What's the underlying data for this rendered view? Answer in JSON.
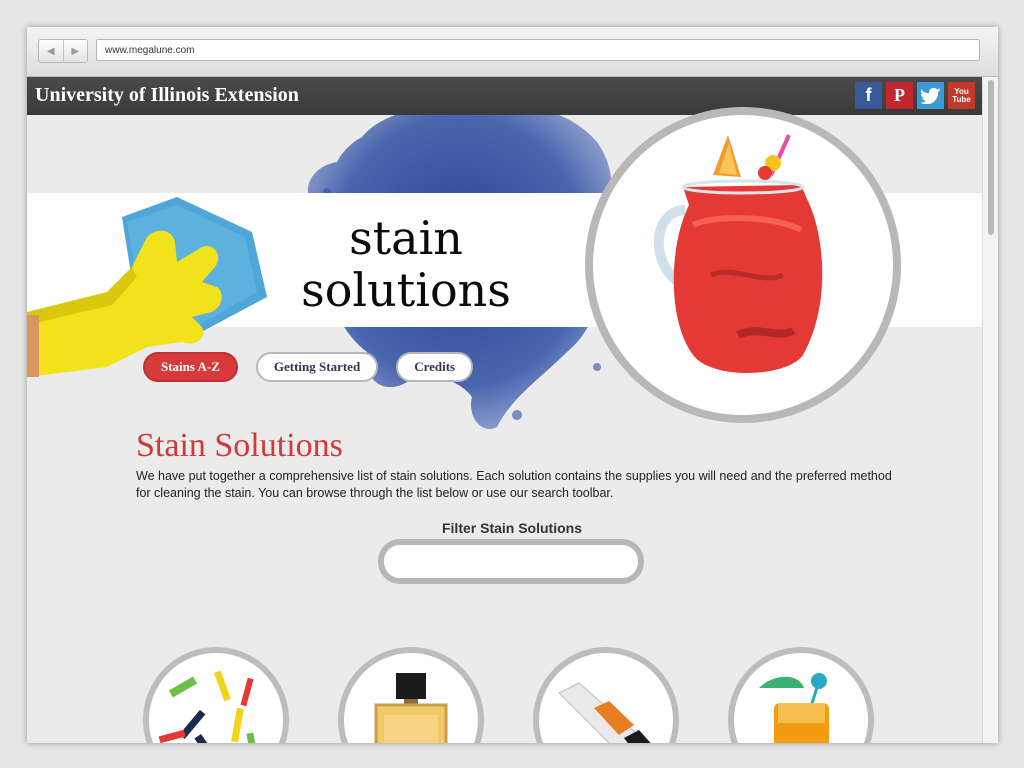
{
  "browser": {
    "url": "www.megalune.com",
    "back_glyph": "◀",
    "forward_glyph": "▶"
  },
  "header": {
    "brand": "University of Illinois Extension",
    "social": [
      {
        "name": "facebook-icon",
        "glyph": "f",
        "color": "#3b5998"
      },
      {
        "name": "pinterest-icon",
        "glyph": "P",
        "color": "#c1272d"
      },
      {
        "name": "twitter-icon",
        "glyph": "bird",
        "color": "#3b99d4"
      },
      {
        "name": "youtube-icon",
        "glyph": "You Tube",
        "color": "#c0392b"
      }
    ]
  },
  "hero": {
    "title_line1": "stain",
    "title_line2": "solutions"
  },
  "tabs": [
    {
      "label": "Stains A-Z",
      "active": true
    },
    {
      "label": "Getting Started",
      "active": false
    },
    {
      "label": "Credits",
      "active": false
    }
  ],
  "main": {
    "heading": "Stain Solutions",
    "intro": "We have put together a comprehensive list of stain solutions. Each solution contains the supplies you will need and the preferred method for cleaning the stain. You can browse through the list below or use our search toolbar.",
    "filter_label": "Filter Stain Solutions",
    "filter_value": ""
  },
  "colors": {
    "accent_red": "#d0393a",
    "topbar": "#3f3f3f",
    "circle_border": "#b8b8b8"
  },
  "thumbnails": [
    {
      "name": "crayons-thumbnail"
    },
    {
      "name": "perfume-thumbnail"
    },
    {
      "name": "marker-thumbnail"
    },
    {
      "name": "cocktail-thumbnail"
    }
  ]
}
